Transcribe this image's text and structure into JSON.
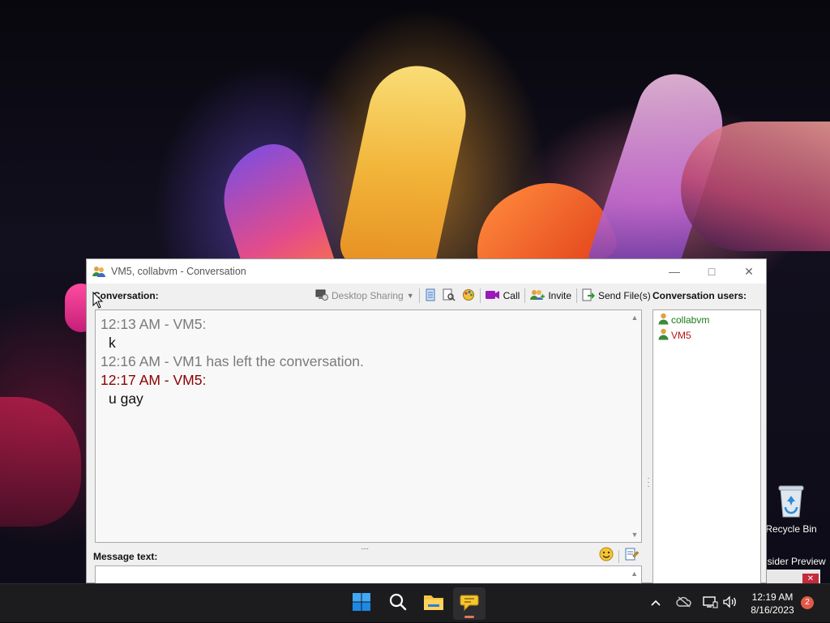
{
  "desktop": {
    "icons": [
      {
        "label": "Recycle Bin"
      },
      {
        "label": "nsider Preview",
        "sub": "2"
      }
    ]
  },
  "window": {
    "title": "VM5, collabvm - Conversation",
    "controls": {
      "minimize": "—",
      "maximize": "□",
      "close": "✕"
    },
    "conversation_label": "Conversation:",
    "toolbar": {
      "desktop_sharing": "Desktop Sharing",
      "call": "Call",
      "invite": "Invite",
      "send_files": "Send File(s)"
    },
    "messages": [
      {
        "header": "12:13 AM - VM5:",
        "text": "k",
        "style": "gray"
      },
      {
        "header": "12:16 AM - VM1 has left the conversation.",
        "text": "",
        "style": "gray"
      },
      {
        "header": "12:17 AM - VM5:",
        "text": "u gay",
        "style": "red"
      }
    ],
    "message_text_label": "Message text:",
    "users_label": "Conversation users:",
    "users": [
      {
        "name": "collabvm",
        "color": "#1a7a1a"
      },
      {
        "name": "VM5",
        "color": "#b81414"
      }
    ]
  },
  "taskbar": {
    "apps": [
      {
        "name": "start-button"
      },
      {
        "name": "search-button"
      },
      {
        "name": "file-explorer"
      },
      {
        "name": "messenger",
        "active": true
      }
    ],
    "clock": {
      "time": "12:19 AM",
      "date": "8/16/2023"
    },
    "notification_count": "2"
  },
  "colors": {
    "accent": "#e0785a",
    "gray_text": "#7a7a7a",
    "red_text": "#8b0000",
    "taskbar_bg": "#1c1c1e"
  }
}
